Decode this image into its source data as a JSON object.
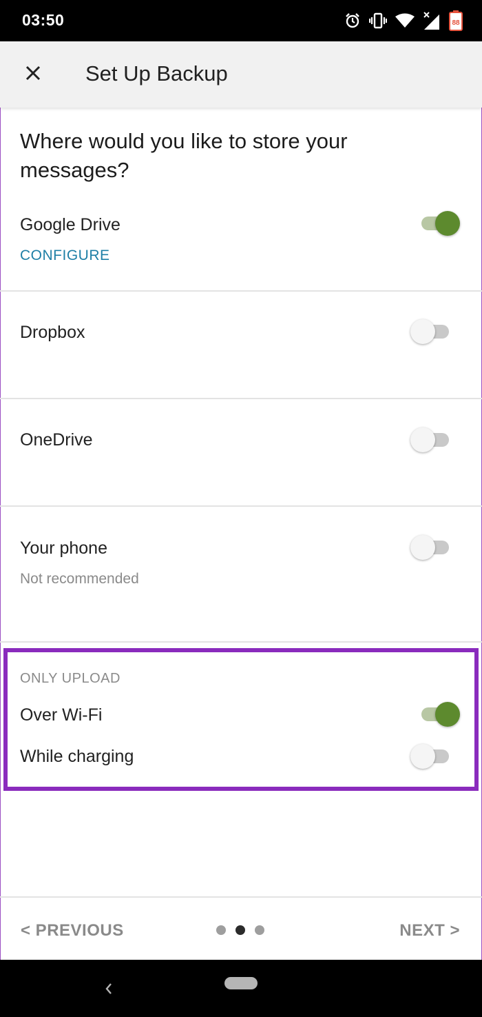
{
  "status_bar": {
    "time": "03:50",
    "icons": [
      "alarm-icon",
      "vibrate-icon",
      "wifi-icon",
      "signal-icon",
      "battery-icon"
    ],
    "battery_text": "88"
  },
  "app_bar": {
    "close_icon": "close-icon",
    "title": "Set Up Backup"
  },
  "question": "Where would you like to store your messages?",
  "options": [
    {
      "label": "Google Drive",
      "link": "CONFIGURE",
      "enabled": true
    },
    {
      "label": "Dropbox",
      "enabled": false
    },
    {
      "label": "OneDrive",
      "enabled": false
    },
    {
      "label": "Your phone",
      "sub": "Not recommended",
      "enabled": false
    }
  ],
  "only_upload": {
    "heading": "ONLY UPLOAD",
    "items": [
      {
        "label": "Over Wi-Fi",
        "enabled": true
      },
      {
        "label": "While charging",
        "enabled": false
      }
    ]
  },
  "navigation": {
    "previous": "< PREVIOUS",
    "next": "NEXT >",
    "page_count": 3,
    "current_page": 2
  },
  "colors": {
    "accent_green": "#5d8a2e",
    "link_blue": "#1e7fa6",
    "highlight_purple": "#8a2bbd"
  }
}
